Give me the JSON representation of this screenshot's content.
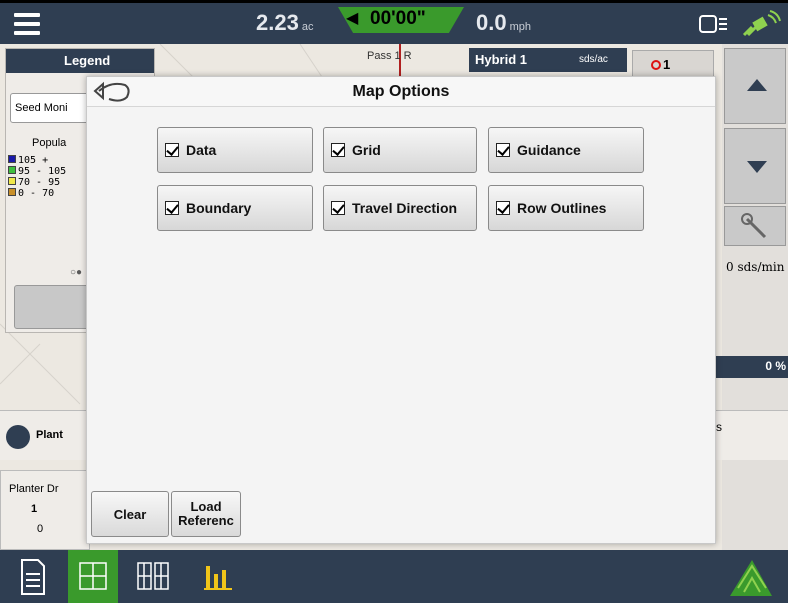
{
  "topbar": {
    "area_value": "2.23",
    "area_unit": "ac",
    "timer": "00'00\"",
    "speed_value": "0.0",
    "speed_unit": "mph"
  },
  "background": {
    "legend_title": "Legend",
    "seed_monitor_button": "Seed Moni",
    "population_label": "Popula",
    "legend_items": [
      {
        "label": "105 +",
        "color": "#1a1aa8"
      },
      {
        "label": "95 - 105",
        "color": "#3fbf3f"
      },
      {
        "label": "70 - 95",
        "color": "#f0e84a"
      },
      {
        "label": "0 - 70",
        "color": "#c9902a"
      }
    ],
    "pass_label": "Pass 1 R",
    "hybrid_label": "Hybrid 1",
    "hybrid_unit": "sds/ac",
    "target_count": "1",
    "rate_readout": "0 sds/min",
    "percent_readout": "0 %",
    "planter_label": "Plant",
    "planter_dr_label": "Planter Dr",
    "planter_dr_row": "1",
    "planter_dr_value": "0",
    "s_label": "s"
  },
  "dialog": {
    "title": "Map Options",
    "options": [
      {
        "label": "Data",
        "checked": true
      },
      {
        "label": "Grid",
        "checked": true
      },
      {
        "label": "Guidance",
        "checked": true
      },
      {
        "label": "Boundary",
        "checked": true
      },
      {
        "label": "Travel Direction",
        "checked": true
      },
      {
        "label": "Row Outlines",
        "checked": true
      }
    ],
    "clear_button": "Clear",
    "load_reference_line1": "Load",
    "load_reference_line2": "Referenc"
  },
  "colors": {
    "bar": "#2f3e52",
    "accent": "#3a9a2c"
  }
}
